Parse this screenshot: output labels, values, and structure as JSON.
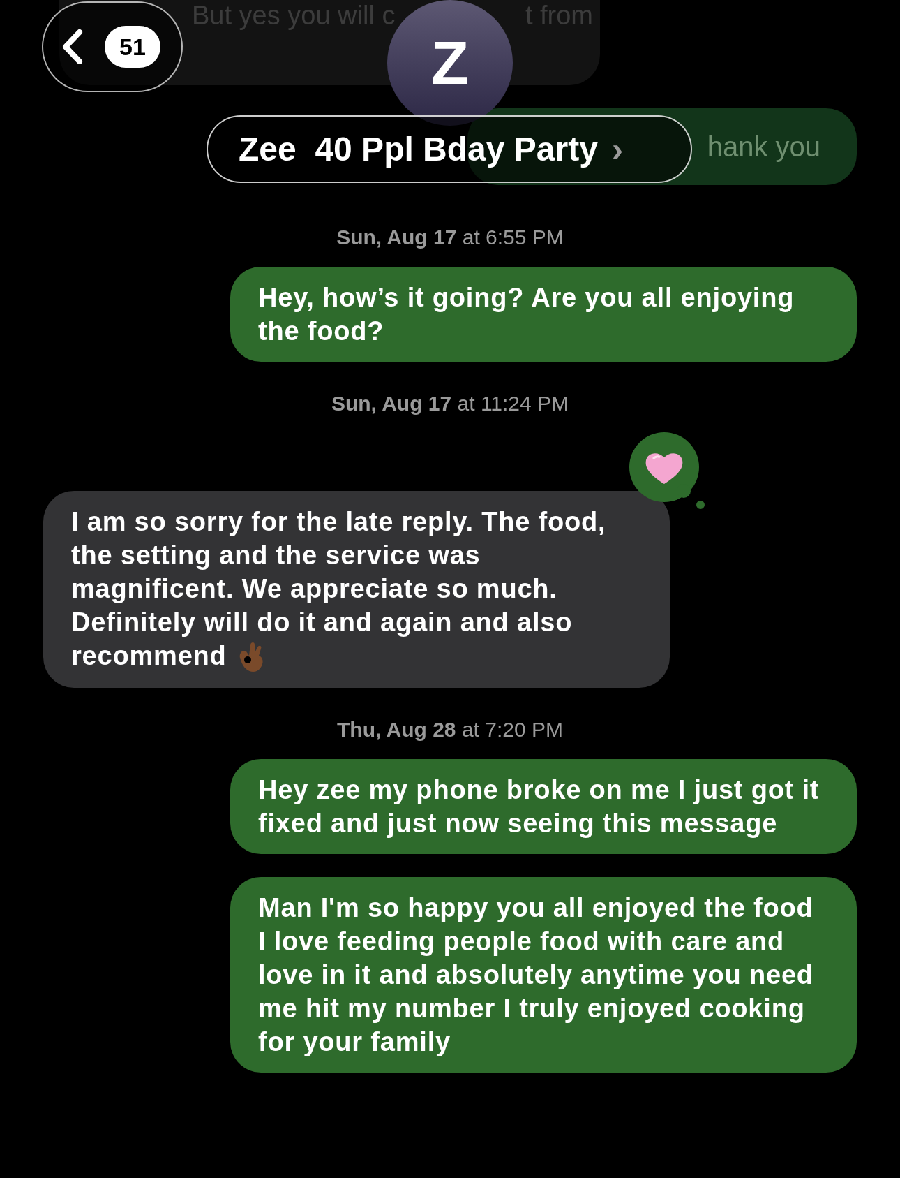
{
  "header": {
    "back_count": "51",
    "avatar_initial": "Z",
    "title": "Zee  40 Ppl Bday Party",
    "chevron": "›"
  },
  "background_messages": [
    {
      "kind": "received",
      "parts": [
        "But yes you will c",
        "t from"
      ]
    },
    {
      "kind": "sent",
      "parts": [
        "hank you"
      ]
    }
  ],
  "thread": [
    {
      "kind": "timestamp",
      "text": "**Sun, Aug 17** at 6:55 PM"
    },
    {
      "kind": "sent",
      "text": "Hey, how’s it going? Are you all enjoying the food?"
    },
    {
      "kind": "timestamp",
      "text": "**Sun, Aug 17** at 11:24 PM"
    },
    {
      "kind": "received",
      "text": "I am so sorry for the late reply. The food, the setting and the service was magnificent. We appreciate so much. Definitely will do it and again and also recommend",
      "trailing_emoji": {
        "kind": "ok-hand"
      },
      "reaction": {
        "kind": "heart"
      }
    },
    {
      "kind": "timestamp",
      "text": "**Thu, Aug 28** at 7:20 PM"
    },
    {
      "kind": "sent",
      "text": "Hey zee my phone broke on me I just got it fixed and just now seeing this message"
    },
    {
      "kind": "sent",
      "text": "Man I'm so happy you all enjoyed the food I love feeding people food with care and love in it and absolutely anytime you need me hit my number I truly enjoyed cooking for your family"
    }
  ]
}
